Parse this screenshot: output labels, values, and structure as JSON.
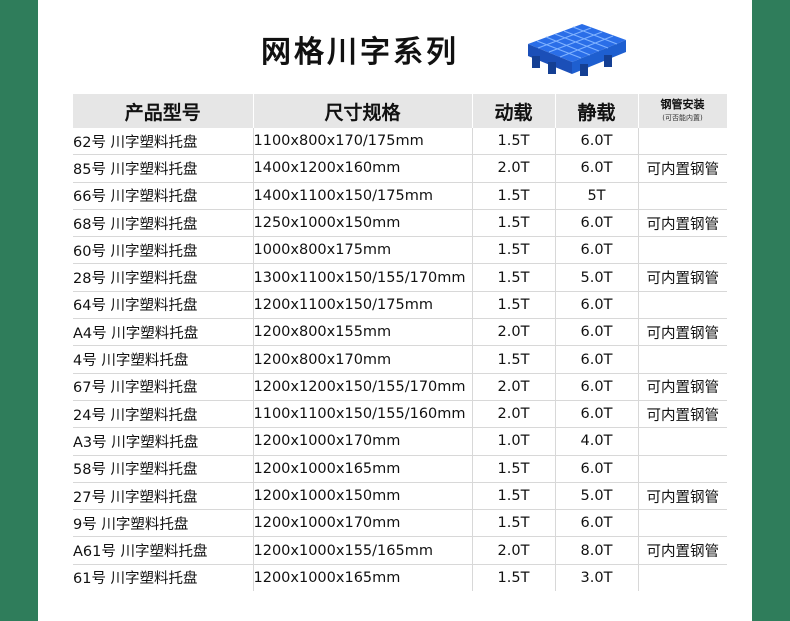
{
  "header": {
    "title": "网格川字系列"
  },
  "table": {
    "columns": [
      "产品型号",
      "尺寸规格",
      "动载",
      "静载",
      "钢管安装"
    ],
    "pipe_note": "(可否能内置)",
    "rows": [
      {
        "model": "62号 川字塑料托盘",
        "size": "1100x800x170/175mm",
        "dynamic": "1.5T",
        "static": "6.0T",
        "pipe": ""
      },
      {
        "model": "85号 川字塑料托盘",
        "size": "1400x1200x160mm",
        "dynamic": "2.0T",
        "static": "6.0T",
        "pipe": "可内置钢管"
      },
      {
        "model": "66号 川字塑料托盘",
        "size": "1400x1100x150/175mm",
        "dynamic": "1.5T",
        "static": "5T",
        "pipe": ""
      },
      {
        "model": "68号 川字塑料托盘",
        "size": "1250x1000x150mm",
        "dynamic": "1.5T",
        "static": "6.0T",
        "pipe": "可内置钢管"
      },
      {
        "model": "60号 川字塑料托盘",
        "size": "1000x800x175mm",
        "dynamic": "1.5T",
        "static": "6.0T",
        "pipe": ""
      },
      {
        "model": "28号 川字塑料托盘",
        "size": "1300x1100x150/155/170mm",
        "dynamic": "1.5T",
        "static": "5.0T",
        "pipe": "可内置钢管"
      },
      {
        "model": "64号 川字塑料托盘",
        "size": "1200x1100x150/175mm",
        "dynamic": "1.5T",
        "static": "6.0T",
        "pipe": ""
      },
      {
        "model": "A4号 川字塑料托盘",
        "size": "1200x800x155mm",
        "dynamic": "2.0T",
        "static": "6.0T",
        "pipe": "可内置钢管"
      },
      {
        "model": "4号 川字塑料托盘",
        "size": "1200x800x170mm",
        "dynamic": "1.5T",
        "static": "6.0T",
        "pipe": ""
      },
      {
        "model": "67号 川字塑料托盘",
        "size": "1200x1200x150/155/170mm",
        "dynamic": "2.0T",
        "static": "6.0T",
        "pipe": "可内置钢管"
      },
      {
        "model": "24号 川字塑料托盘",
        "size": "1100x1100x150/155/160mm",
        "dynamic": "2.0T",
        "static": "6.0T",
        "pipe": "可内置钢管"
      },
      {
        "model": "A3号 川字塑料托盘",
        "size": "1200x1000x170mm",
        "dynamic": "1.0T",
        "static": "4.0T",
        "pipe": ""
      },
      {
        "model": "58号 川字塑料托盘",
        "size": "1200x1000x165mm",
        "dynamic": "1.5T",
        "static": "6.0T",
        "pipe": ""
      },
      {
        "model": "27号 川字塑料托盘",
        "size": "1200x1000x150mm",
        "dynamic": "1.5T",
        "static": "5.0T",
        "pipe": "可内置钢管"
      },
      {
        "model": "9号 川字塑料托盘",
        "size": "1200x1000x170mm",
        "dynamic": "1.5T",
        "static": "6.0T",
        "pipe": ""
      },
      {
        "model": "A61号 川字塑料托盘",
        "size": "1200x1000x155/165mm",
        "dynamic": "2.0T",
        "static": "8.0T",
        "pipe": "可内置钢管"
      },
      {
        "model": "61号 川字塑料托盘",
        "size": "1200x1000x165mm",
        "dynamic": "1.5T",
        "static": "3.0T",
        "pipe": ""
      }
    ]
  },
  "colors": {
    "frame": "#2f7d5b",
    "header_bg": "#e6e6e6",
    "pipe_text": "#e53935",
    "pallet_blue": "#1e5fd0"
  },
  "icons": {
    "pallet": "plastic-pallet-icon"
  }
}
